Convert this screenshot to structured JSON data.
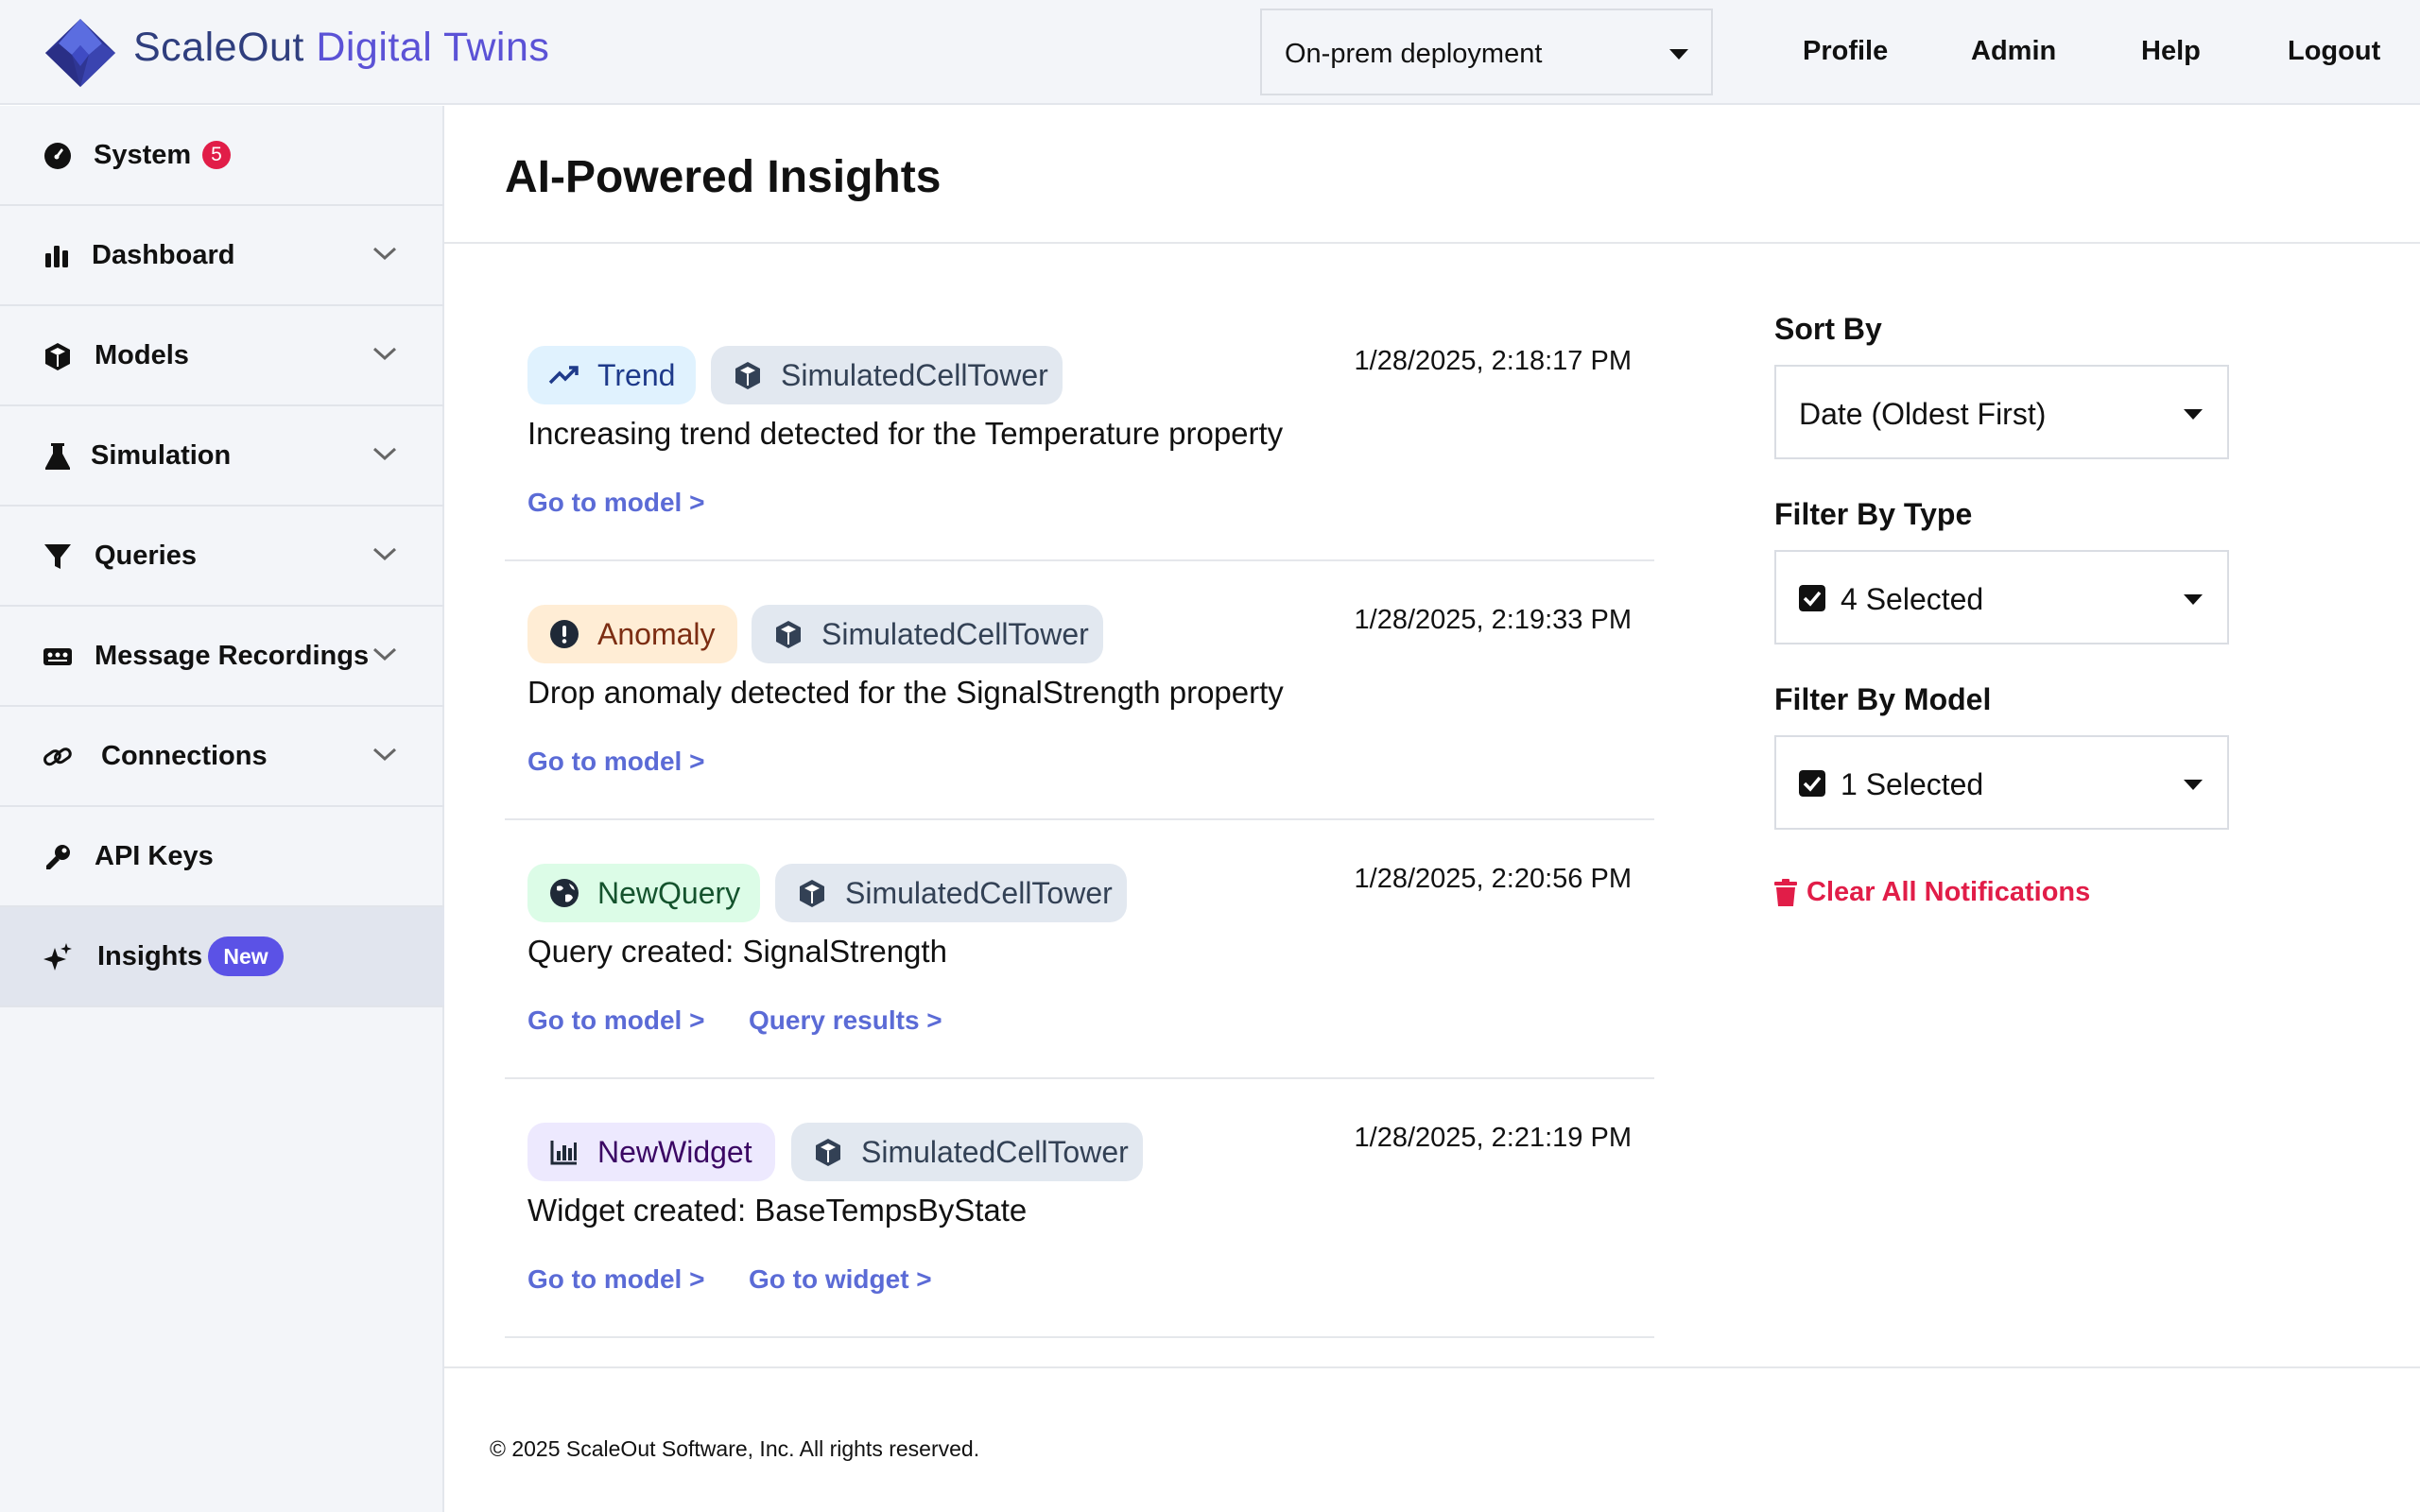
{
  "header": {
    "brand_part1": "ScaleOut",
    "brand_part2": "Digital Twins",
    "deployment": "On-prem deployment",
    "nav": [
      "Profile",
      "Admin",
      "Help",
      "Logout"
    ]
  },
  "sidebar": {
    "items": [
      {
        "label": "System",
        "icon": "gauge-icon",
        "badge": "5"
      },
      {
        "label": "Dashboard",
        "icon": "bar-chart-icon"
      },
      {
        "label": "Models",
        "icon": "cube-icon"
      },
      {
        "label": "Simulation",
        "icon": "flask-icon"
      },
      {
        "label": "Queries",
        "icon": "filter-icon"
      },
      {
        "label": "Message Recordings",
        "icon": "recording-icon"
      },
      {
        "label": "Connections",
        "icon": "link-icon"
      },
      {
        "label": "API Keys",
        "icon": "key-icon"
      },
      {
        "label": "Insights",
        "icon": "sparkle-icon",
        "badge": "New"
      }
    ]
  },
  "main": {
    "title": "AI-Powered Insights",
    "insights": [
      {
        "type": "Trend",
        "model": "SimulatedCellTower",
        "timestamp": "1/28/2025, 2:18:17 PM",
        "message": "Increasing trend detected for the Temperature property",
        "links": [
          "Go to model >"
        ]
      },
      {
        "type": "Anomaly",
        "model": "SimulatedCellTower",
        "timestamp": "1/28/2025, 2:19:33 PM",
        "message": "Drop anomaly detected for the SignalStrength property",
        "links": [
          "Go to model >"
        ]
      },
      {
        "type": "NewQuery",
        "model": "SimulatedCellTower",
        "timestamp": "1/28/2025, 2:20:56 PM",
        "message": "Query created: SignalStrength",
        "links": [
          "Go to model >",
          "Query results >"
        ]
      },
      {
        "type": "NewWidget",
        "model": "SimulatedCellTower",
        "timestamp": "1/28/2025, 2:21:19 PM",
        "message": "Widget created: BaseTempsByState",
        "links": [
          "Go to model >",
          "Go to widget >"
        ]
      }
    ]
  },
  "panel": {
    "sort_label": "Sort By",
    "sort_value": "Date (Oldest First)",
    "type_label": "Filter By Type",
    "type_value": "4 Selected",
    "model_label": "Filter By Model",
    "model_value": "1 Selected",
    "clear_label": "Clear All Notifications"
  },
  "footer": {
    "copyright": "© 2025 ScaleOut Software, Inc. All rights reserved."
  },
  "colors": {
    "accent": "#5b52e6",
    "brand": "#2f3e7e",
    "link": "#5b6bd6",
    "danger": "#e11d48",
    "chip_trend": "#e0f2fe",
    "chip_anomaly": "#ffedd5",
    "chip_query": "#dcfce7",
    "chip_widget": "#ede9fe",
    "chip_model": "#e2e8f0"
  }
}
